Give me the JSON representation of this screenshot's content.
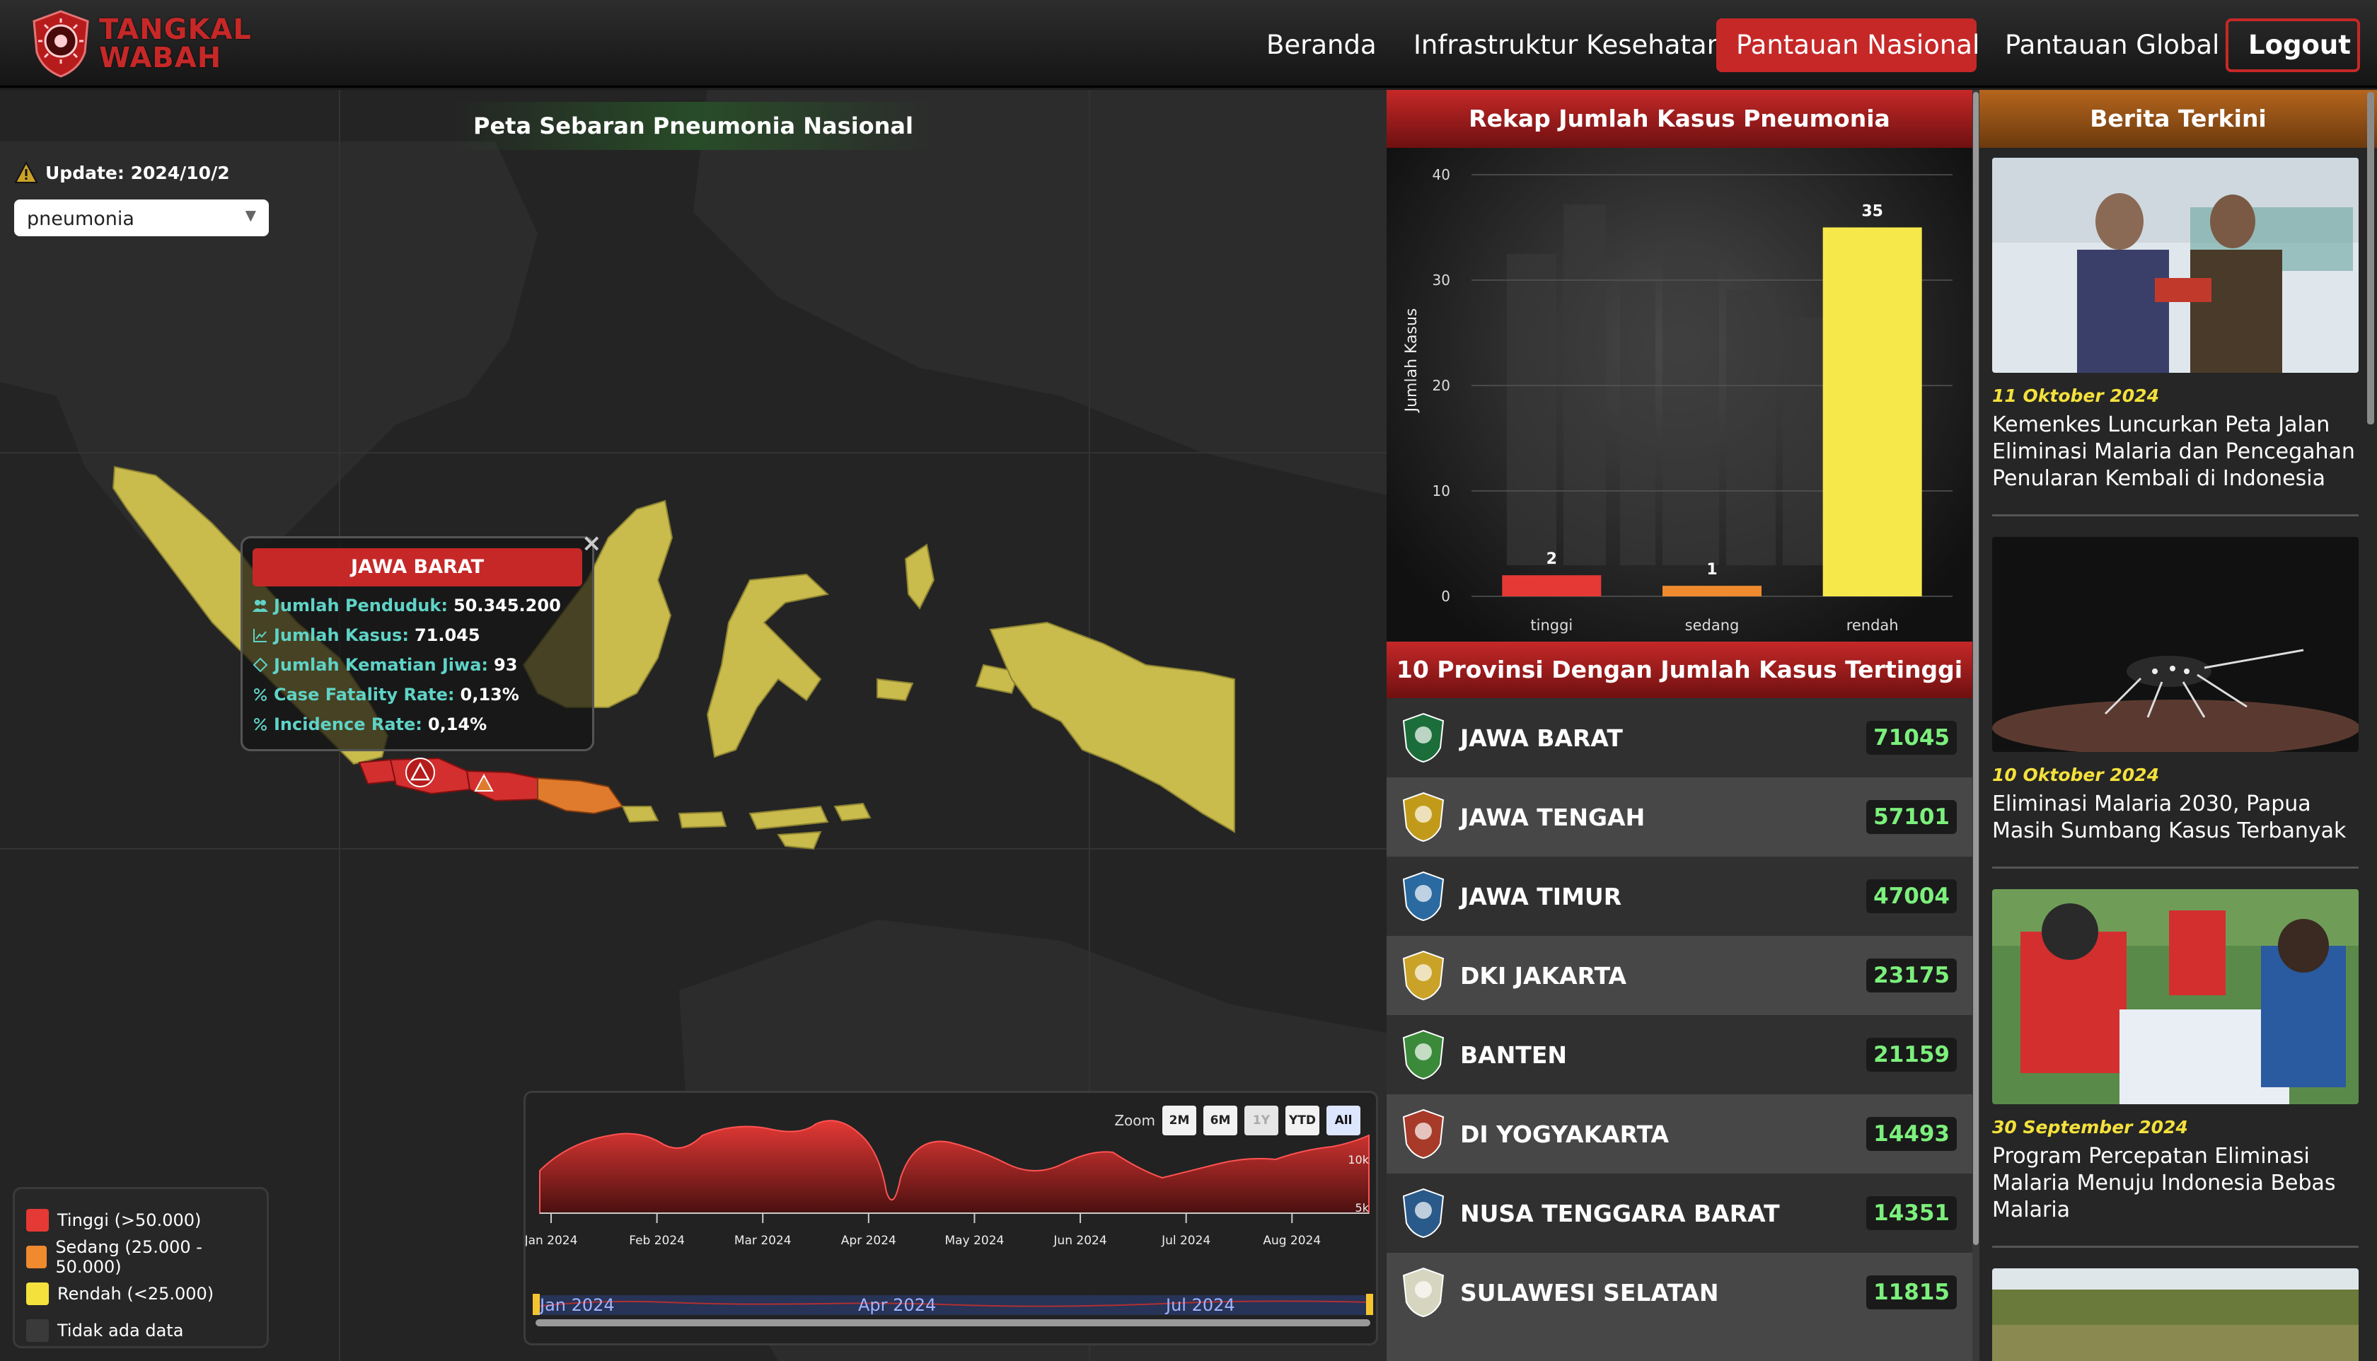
{
  "header": {
    "logo_text_line1": "TANGKAL",
    "logo_text_line2": "WABAH",
    "nav": [
      "Beranda",
      "Infrastruktur Kesehatan",
      "Pantauan Nasional",
      "Pantauan Global"
    ],
    "logout": "Logout",
    "active_nav": "Pantauan Nasional"
  },
  "map": {
    "title": "Peta Sebaran Pneumonia Nasional",
    "update": "Update: 2024/10/2",
    "select_value": "pneumonia",
    "popup": {
      "title": "JAWA BARAT",
      "rows": [
        {
          "label": "Jumlah Penduduk:",
          "value": "50.345.200",
          "icon": "people-icon"
        },
        {
          "label": "Jumlah Kasus:",
          "value": "71.045",
          "icon": "trend-icon"
        },
        {
          "label": "Jumlah Kematian Jiwa:",
          "value": "93",
          "icon": "diamond-icon"
        },
        {
          "label": "Case Fatality Rate:",
          "value": "0,13%",
          "icon": "percent-icon"
        },
        {
          "label": "Incidence Rate:",
          "value": "0,14%",
          "icon": "percent-icon"
        }
      ],
      "close": "×"
    },
    "legend": [
      {
        "label": "Tinggi (>50.000)",
        "color": "#e53935"
      },
      {
        "label": "Sedang (25.000 - 50.000)",
        "color": "#ef8a2f"
      },
      {
        "label": "Rendah (<25.000)",
        "color": "#f4e13c"
      },
      {
        "label": "Tidak ada data",
        "color": "#3a3a3a"
      }
    ],
    "colors": {
      "high": "#d32f2f",
      "medium": "#e07a2c",
      "low": "#c9bb4c"
    }
  },
  "timeline": {
    "zoom_label": "Zoom",
    "zoom_buttons": [
      "2M",
      "6M",
      "1Y",
      "YTD",
      "All"
    ],
    "zoom_selected": "All",
    "zoom_disabled": [
      "1Y"
    ],
    "y_labels": [
      "10k",
      "5k"
    ],
    "x_labels": [
      "Jan 2024",
      "Feb 2024",
      "Mar 2024",
      "Apr 2024",
      "May 2024",
      "Jun 2024",
      "Jul 2024",
      "Aug 2024"
    ],
    "navigator_labels": [
      "Jan 2024",
      "Apr 2024",
      "Jul 2024"
    ]
  },
  "rekap": {
    "title": "Rekap Jumlah Kasus Pneumonia"
  },
  "chart_data": {
    "type": "bar",
    "title": "Rekap Jumlah Kasus Pneumonia",
    "categories": [
      "tinggi",
      "sedang",
      "rendah"
    ],
    "values": [
      2,
      1,
      35
    ],
    "colors": [
      "#e53935",
      "#ef8a2f",
      "#f6e84a"
    ],
    "ylabel": "Jumlah Kasus",
    "xlabel": "",
    "ylim": [
      0,
      40
    ],
    "yticks": [
      0,
      10,
      20,
      30,
      40
    ],
    "grid": true
  },
  "provinces": {
    "title": "10 Provinsi Dengan Jumlah Kasus Tertinggi",
    "items": [
      {
        "name": "JAWA BARAT",
        "value": "71045"
      },
      {
        "name": "JAWA TENGAH",
        "value": "57101"
      },
      {
        "name": "JAWA TIMUR",
        "value": "47004"
      },
      {
        "name": "DKI JAKARTA",
        "value": "23175"
      },
      {
        "name": "BANTEN",
        "value": "21159"
      },
      {
        "name": "DI YOGYAKARTA",
        "value": "14493"
      },
      {
        "name": "NUSA TENGGARA BARAT",
        "value": "14351"
      },
      {
        "name": "SULAWESI SELATAN",
        "value": "11815"
      }
    ]
  },
  "news": {
    "title": "Berita Terkini",
    "items": [
      {
        "date": "11 Oktober 2024",
        "title": "Kemenkes Luncurkan Peta Jalan Eliminasi Malaria dan Pencegahan Penularan Kembali di Indonesia"
      },
      {
        "date": "10 Oktober 2024",
        "title": "Eliminasi Malaria 2030, Papua Masih Sumbang Kasus Terbanyak"
      },
      {
        "date": "30 September 2024",
        "title": "Program Percepatan Eliminasi Malaria Menuju Indonesia Bebas Malaria"
      }
    ]
  }
}
